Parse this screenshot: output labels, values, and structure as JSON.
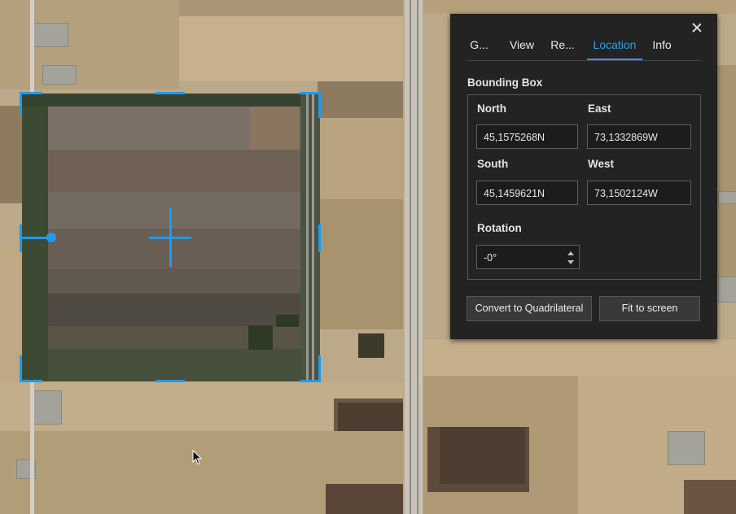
{
  "panel": {
    "tabs": [
      {
        "label": "G..."
      },
      {
        "label": "View"
      },
      {
        "label": "Re..."
      },
      {
        "label": "Location"
      },
      {
        "label": "Info"
      }
    ],
    "active_tab": "Location",
    "bounding_box": {
      "title": "Bounding Box",
      "north_label": "North",
      "north_value": "45,1575268N",
      "east_label": "East",
      "east_value": "73,1332869W",
      "south_label": "South",
      "south_value": "45,1459621N",
      "west_label": "West",
      "west_value": "73,1502124W"
    },
    "rotation": {
      "label": "Rotation",
      "value": "-0°"
    },
    "buttons": {
      "convert": "Convert to Quadrilateral",
      "fit": "Fit to screen"
    }
  },
  "colors": {
    "accent": "#2a9fe8",
    "handle": "#1d9bf0",
    "panel_bg": "#232323"
  },
  "icons": [
    "close-icon",
    "move-crosshair-icon",
    "rotate-handle-icon",
    "mouse-pointer-icon",
    "spinner-arrows-icon"
  ]
}
